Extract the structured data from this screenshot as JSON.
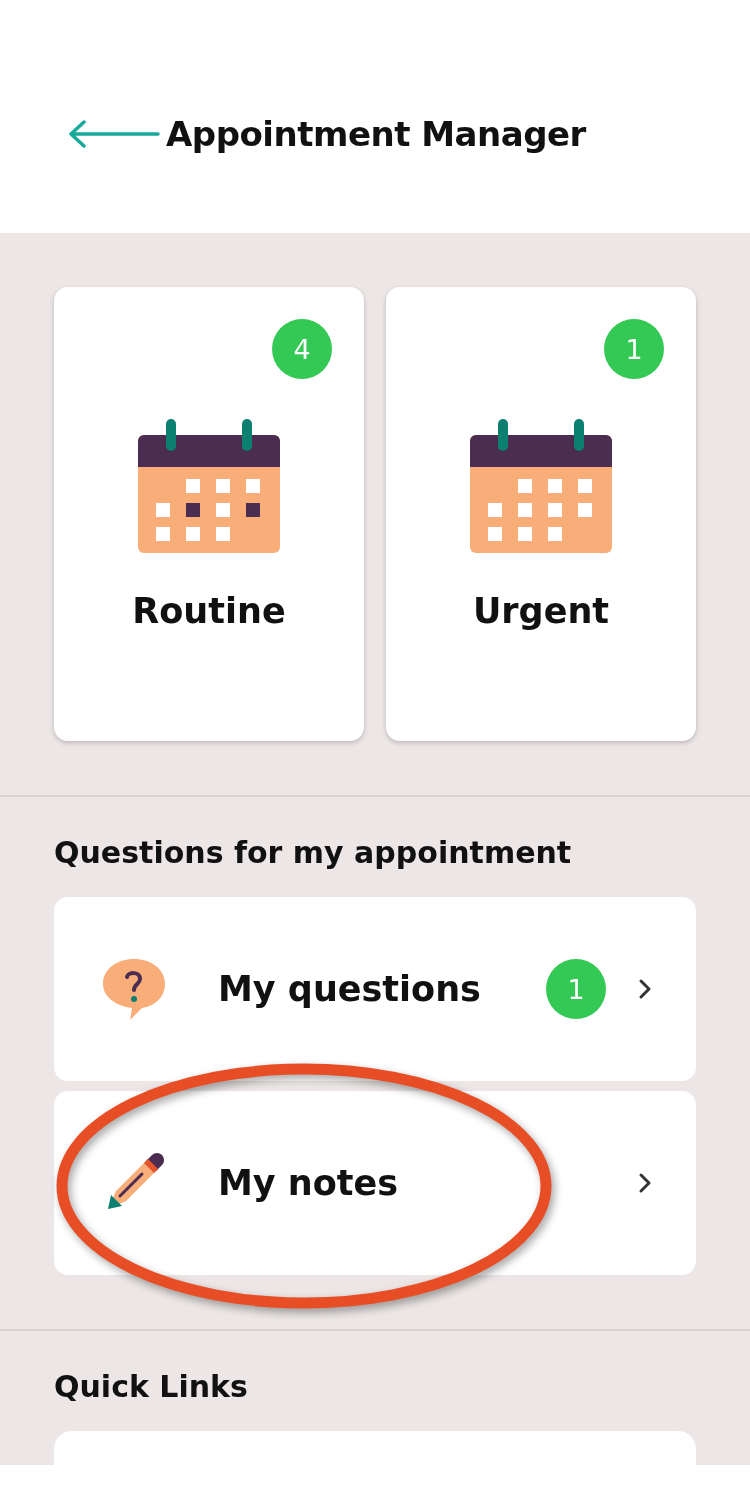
{
  "header": {
    "title": "Appointment Manager"
  },
  "cards": [
    {
      "label": "Routine",
      "badge": "4",
      "kind": "marked"
    },
    {
      "label": "Urgent",
      "badge": "1",
      "kind": "plain"
    }
  ],
  "questions_section": {
    "heading": "Questions for my appointment",
    "rows": [
      {
        "label": "My questions",
        "badge": "1",
        "kind": "questions"
      },
      {
        "label": "My notes",
        "kind": "notes"
      }
    ]
  },
  "quick_links": {
    "heading": "Quick Links"
  }
}
